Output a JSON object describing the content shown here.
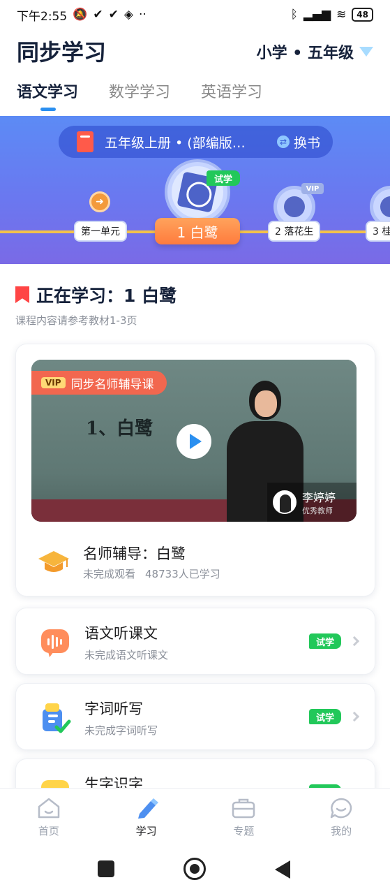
{
  "status_bar": {
    "time": "下午2:55",
    "battery": "48"
  },
  "header": {
    "title": "同步学习",
    "grade": "小学 • 五年级"
  },
  "tabs": [
    {
      "label": "语文学习"
    },
    {
      "label": "数学学习"
    },
    {
      "label": "英语学习"
    }
  ],
  "banner": {
    "book_title": "五年级上册 • (部编版…",
    "swap_label": "换书",
    "unit_label": "第一单元",
    "trial_badge": "试学",
    "lessons": [
      {
        "label": "1 白鹭"
      },
      {
        "label": "2 落花生"
      },
      {
        "label": "3 桂"
      }
    ],
    "vip_tag": "VIP"
  },
  "current": {
    "title": "正在学习：1 白鹭",
    "subtitle": "课程内容请参考教材1-3页"
  },
  "video": {
    "vip_chip": "VIP",
    "banner_text": "同步名师辅导课",
    "board_text": "1、白鹭",
    "teacher_name": "李婷婷",
    "teacher_role": "优秀教师",
    "course_title": "名师辅导：白鹭",
    "course_status": "未完成观看",
    "course_count": "48733人已学习"
  },
  "rows": [
    {
      "title": "语文听课文",
      "subtitle": "未完成语文听课文",
      "badge": "试学"
    },
    {
      "title": "字词听写",
      "subtitle": "未完成字词听写",
      "badge": "试学"
    },
    {
      "title": "生字识字",
      "subtitle": "",
      "badge": ""
    }
  ],
  "bottom_nav": [
    {
      "label": "首页",
      "icon": "home-icon"
    },
    {
      "label": "学习",
      "icon": "pencil-icon"
    },
    {
      "label": "专题",
      "icon": "briefcase-icon"
    },
    {
      "label": "我的",
      "icon": "chat-icon"
    }
  ],
  "colors": {
    "accent": "#2a8ff0",
    "trial_green": "#22c85a",
    "orange": "#ff7b3d",
    "banner": "#6a78f0"
  }
}
